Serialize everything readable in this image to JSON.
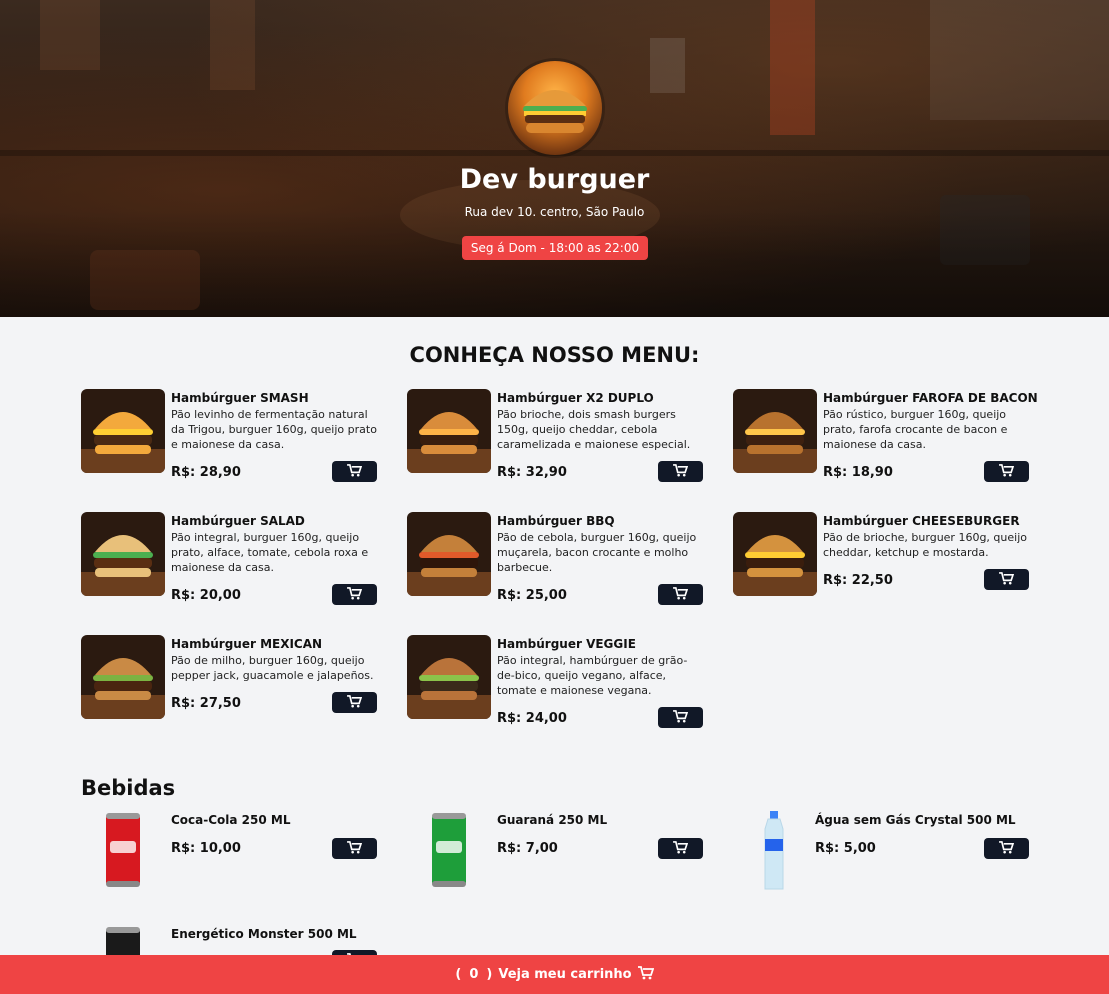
{
  "header": {
    "title": "Dev burguer",
    "address": "Rua dev 10. centro, São Paulo",
    "hours": "Seg á Dom - 18:00 as 22:00"
  },
  "menu": {
    "title": "CONHEÇA NOSSO MENU:",
    "items": [
      {
        "name": "Hambúrguer SMASH",
        "description": "Pão levinho de fermentação natural da Trigou, burguer 160g, queijo prato e maionese da casa.",
        "price": "R$: 28,90"
      },
      {
        "name": "Hambúrguer X2 DUPLO",
        "description": "Pão brioche, dois smash burgers 150g, queijo cheddar, cebola caramelizada e maionese especial.",
        "price": "R$: 32,90"
      },
      {
        "name": "Hambúrguer FAROFA DE BACON",
        "description": "Pão rústico, burguer 160g, queijo prato, farofa crocante de bacon e maionese da casa.",
        "price": "R$: 18,90"
      },
      {
        "name": "Hambúrguer SALAD",
        "description": "Pão integral, burguer 160g, queijo prato, alface, tomate, cebola roxa e maionese da casa.",
        "price": "R$: 20,00"
      },
      {
        "name": "Hambúrguer BBQ",
        "description": "Pão de cebola, burguer 160g, queijo muçarela, bacon crocante e molho barbecue.",
        "price": "R$: 25,00"
      },
      {
        "name": "Hambúrguer CHEESEBURGER",
        "description": "Pão de brioche, burguer 160g, queijo cheddar, ketchup e mostarda.",
        "price": "R$: 22,50"
      },
      {
        "name": "Hambúrguer MEXICAN",
        "description": "Pão de milho, burguer 160g, queijo pepper jack, guacamole e jalapeños.",
        "price": "R$: 27,50"
      },
      {
        "name": "Hambúrguer VEGGIE",
        "description": "Pão integral, hambúrguer de grão-de-bico, queijo vegano, alface, tomate e maionese vegana.",
        "price": "R$: 24,00"
      }
    ]
  },
  "drinks": {
    "title": "Bebidas",
    "items": [
      {
        "name": "Coca-Cola 250 ML",
        "price": "R$: 10,00",
        "color": "#d71920"
      },
      {
        "name": "Guaraná 250 ML",
        "price": "R$: 7,00",
        "color": "#1e9e3a"
      },
      {
        "name": "Água sem Gás Crystal 500 ML",
        "price": "R$: 5,00",
        "color": "#cfe8f5"
      },
      {
        "name": "Energético Monster 500 ML",
        "price": "",
        "color": "#1a1a1a"
      }
    ]
  },
  "cart": {
    "open": "(",
    "count": "0",
    "close": ")",
    "label": "Veja meu carrinho"
  },
  "icons": {
    "cart": "cart-icon"
  },
  "colors": {
    "accent": "#ef4444",
    "button": "#111827",
    "background": "#f3f4f6"
  }
}
